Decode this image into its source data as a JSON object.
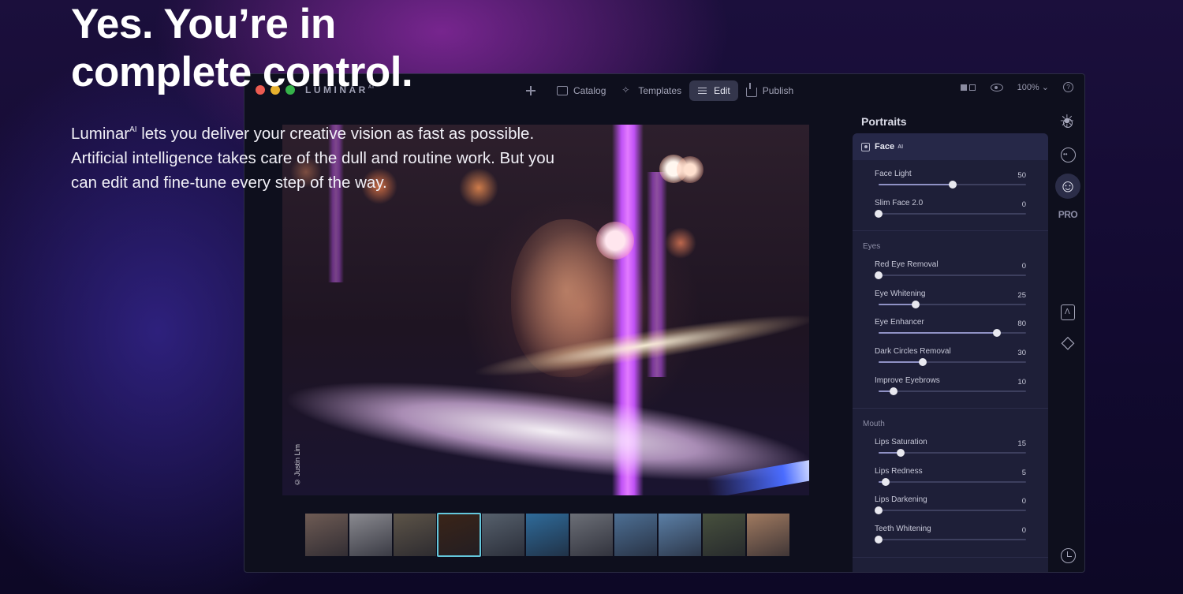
{
  "hero": {
    "headline_line1": "Yes. You’re in",
    "headline_line2": "complete control.",
    "brand": "Luminar",
    "brand_sup": "AI",
    "body": " lets you deliver your creative vision as fast as possible. Artificial intelligence takes care of the dull and routine work. But you can edit and fine-tune every step of the way."
  },
  "app": {
    "logo": "LUMINAR",
    "logo_sup": "AI",
    "nav": [
      {
        "label": "Catalog",
        "icon": "folder-icon"
      },
      {
        "label": "Templates",
        "icon": "sparkle-icon"
      },
      {
        "label": "Edit",
        "icon": "sliders-icon",
        "active": true
      },
      {
        "label": "Publish",
        "icon": "share-icon"
      }
    ],
    "zoom": "100%",
    "photo_credit": "© Justin Lim",
    "filmstrip": {
      "count": 11,
      "selected_index": 3,
      "thumb_colors": [
        "#6e5b54",
        "#8a8a90",
        "#5d5448",
        "#3a2418",
        "#56606c",
        "#2f6b9a",
        "#6c6f77",
        "#4d6f94",
        "#5b7fa6",
        "#47503d",
        "#a07a60"
      ]
    },
    "panel": {
      "title": "Portraits",
      "group": "Face",
      "group_sup": "AI",
      "sections": [
        {
          "label": "",
          "sliders": [
            {
              "label": "Face Light",
              "value": 50,
              "fraction": 0.5
            },
            {
              "label": "Slim Face 2.0",
              "value": 0,
              "fraction": 0.0
            }
          ]
        },
        {
          "label": "Eyes",
          "sliders": [
            {
              "label": "Red Eye Removal",
              "value": 0,
              "fraction": 0.0
            },
            {
              "label": "Eye Whitening",
              "value": 25,
              "fraction": 0.25
            },
            {
              "label": "Eye Enhancer",
              "value": 80,
              "fraction": 0.8
            },
            {
              "label": "Dark Circles Removal",
              "value": 30,
              "fraction": 0.3
            },
            {
              "label": "Improve Eyebrows",
              "value": 10,
              "fraction": 0.1
            }
          ]
        },
        {
          "label": "Mouth",
          "sliders": [
            {
              "label": "Lips Saturation",
              "value": 15,
              "fraction": 0.15
            },
            {
              "label": "Lips Redness",
              "value": 5,
              "fraction": 0.05
            },
            {
              "label": "Lips Darkening",
              "value": 0,
              "fraction": 0.0
            },
            {
              "label": "Teeth Whitening",
              "value": 0,
              "fraction": 0.0
            }
          ]
        }
      ]
    },
    "rail": {
      "pro_label": "PRO"
    },
    "colors": {
      "accent": "#63c7dc",
      "traffic_red": "#ec5b51",
      "traffic_yellow": "#e8b12e",
      "traffic_green": "#36b34a",
      "beam": "#c052f5"
    }
  }
}
